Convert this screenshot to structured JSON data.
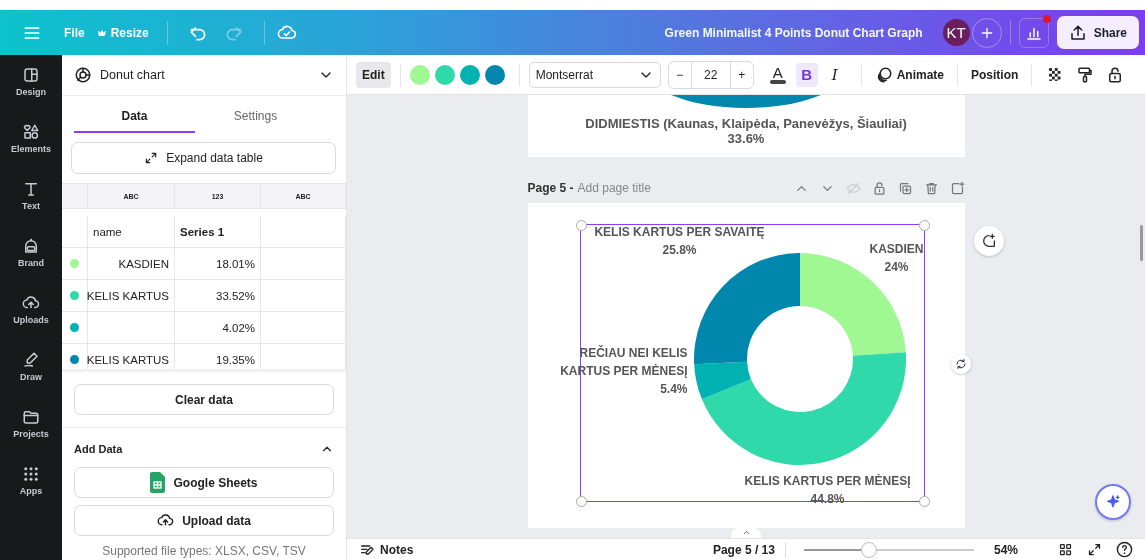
{
  "top_bar": {
    "menu": [
      "File",
      "Resize"
    ],
    "history": [
      {
        "kind": "undo",
        "disabled": false
      },
      {
        "kind": "redo",
        "disabled": true
      }
    ],
    "title": "Green Minimalist 4 Points Donut Chart Graph",
    "avatar": "KT",
    "share": "Share"
  },
  "rail": [
    {
      "kind": "design",
      "label": "Design"
    },
    {
      "kind": "elements",
      "label": "Elements"
    },
    {
      "kind": "text",
      "label": "Text"
    },
    {
      "kind": "brand",
      "label": "Brand"
    },
    {
      "kind": "uploads",
      "label": "Uploads"
    },
    {
      "kind": "draw",
      "label": "Draw"
    },
    {
      "kind": "projects",
      "label": "Projects"
    },
    {
      "kind": "apps",
      "label": "Apps"
    }
  ],
  "panel": {
    "title": "Donut chart",
    "tabs": [
      {
        "label": "Data",
        "selected": true
      },
      {
        "label": "Settings",
        "selected": false
      }
    ],
    "expand": "Expand data table",
    "table": {
      "types": [
        "ABC",
        "123",
        "ABC"
      ],
      "header": [
        "name",
        "Series 1"
      ],
      "rows": [
        {
          "color": "#a0f893",
          "name": "KASDIEN",
          "value": "18.01%"
        },
        {
          "color": "#2fd9a9",
          "name": "KELIS KARTUS",
          "value": "33.52%"
        },
        {
          "color": "#00b2b2",
          "value": "4.02%"
        },
        {
          "color": "#0087ad",
          "name": "KELIS KARTUS",
          "value": "19.35%"
        }
      ]
    },
    "clear": "Clear data",
    "add_data": {
      "title": "Add Data",
      "expanded": true,
      "buttons": [
        {
          "kind": "sheets",
          "label": "Google Sheets"
        },
        {
          "kind": "upload",
          "label": "Upload data"
        }
      ],
      "note": "Supported file types: XLSX, CSV, TSV"
    }
  },
  "toolbar": {
    "edit": "Edit",
    "swatches": [
      {
        "color": "#a0f893"
      },
      {
        "color": "#2fd9a9"
      },
      {
        "color": "#00b2b2"
      },
      {
        "color": "#0087ad"
      }
    ],
    "font": "Montserrat",
    "size": "22",
    "minus": "−",
    "plus": "+",
    "text_color": "A",
    "styles": [
      {
        "kind": "bold",
        "glyph": "B",
        "selected": true
      },
      {
        "kind": "italic",
        "glyph": "I",
        "selected": false
      }
    ],
    "animate": "Animate",
    "position": "Position"
  },
  "canvas": {
    "previous_page": {
      "label": "DIDMIESTIS (Kaunas, Klaipėda, Panevėžys, Šiauliai)",
      "value": "33.6%"
    },
    "page": {
      "number": "Page 5 -",
      "title_placeholder": "Add page title",
      "chart_data": {
        "type": "donut",
        "categories": [
          "KASDIEN",
          "KELIS KARTUS PER MĖNESĮ",
          "REČIAU NEI KELIS KARTUS PER MĖNESĮ",
          "KELIS KARTUS PER SAVAITĘ"
        ],
        "values": [
          24,
          44.8,
          5.4,
          25.8
        ],
        "value_labels": [
          "24%",
          "44.8%",
          "5.4%",
          "25.8%"
        ]
      }
    }
  },
  "bottom_bar": {
    "notes": "Notes",
    "page": "Page 5 / 13",
    "zoom": {
      "level": 0.38
    },
    "zoom_label": "54%"
  }
}
